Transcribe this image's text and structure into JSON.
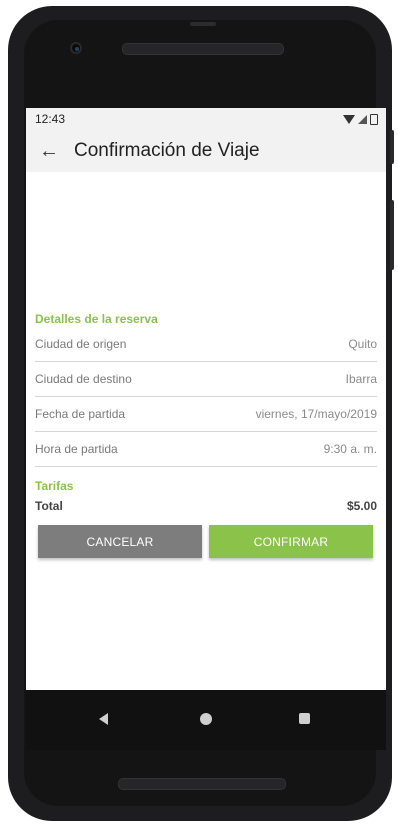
{
  "status_bar": {
    "time": "12:43"
  },
  "app_bar": {
    "back_icon": "arrow-left-icon",
    "title": "Confirmación de Viaje"
  },
  "booking_details": {
    "heading": "Detalles de la reserva",
    "rows": [
      {
        "label": "Ciudad de origen",
        "value": "Quito"
      },
      {
        "label": "Ciudad de destino",
        "value": "Ibarra"
      },
      {
        "label": "Fecha de partida",
        "value": "viernes, 17/mayo/2019"
      },
      {
        "label": "Hora de partida",
        "value": "9:30 a. m."
      }
    ]
  },
  "fares": {
    "heading": "Tarifas",
    "total_label": "Total",
    "total_value": "$5.00"
  },
  "actions": {
    "cancel_label": "CANCELAR",
    "confirm_label": "CONFIRMAR"
  },
  "colors": {
    "accent": "#8bc34a",
    "cancel_button": "#7d7d7d",
    "confirm_button": "#8bc34a"
  }
}
